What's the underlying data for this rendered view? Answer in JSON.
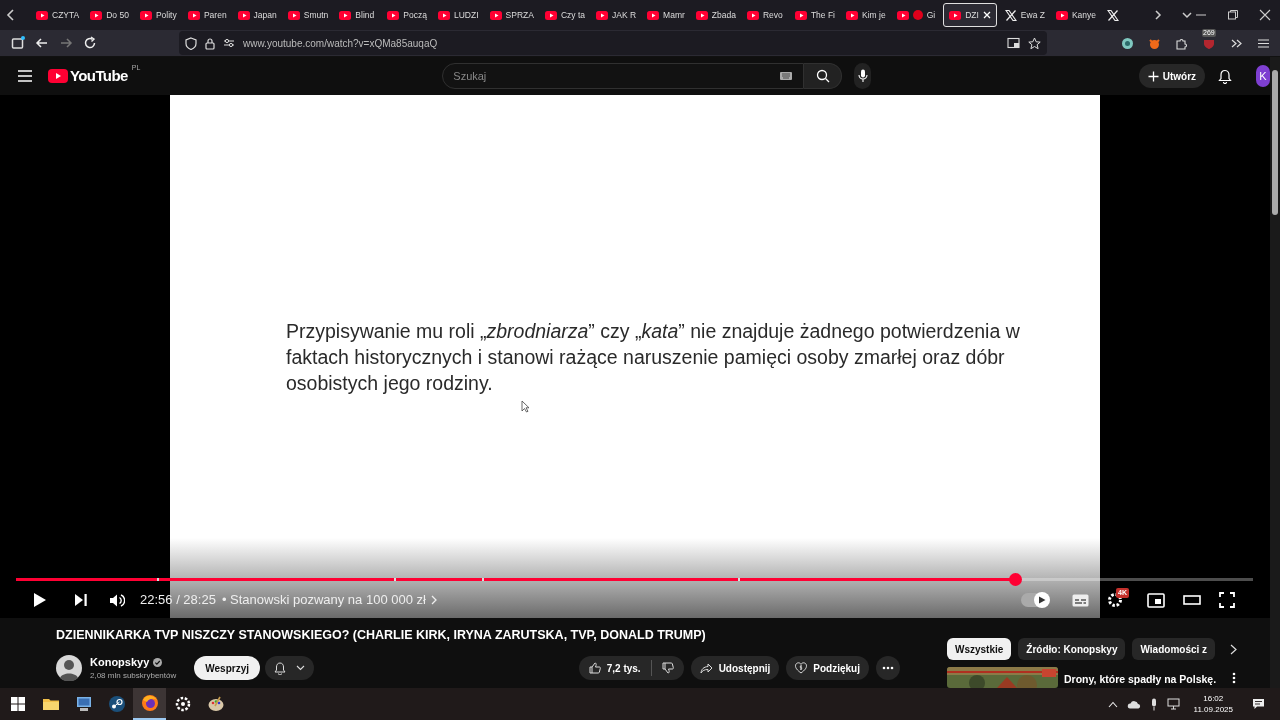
{
  "browser": {
    "tabs": [
      {
        "label": "CZYTA",
        "kind": "youtube",
        "selected": false
      },
      {
        "label": "Do 50",
        "kind": "youtube",
        "selected": false
      },
      {
        "label": "Polity",
        "kind": "youtube",
        "selected": false
      },
      {
        "label": "Paren",
        "kind": "youtube",
        "selected": false
      },
      {
        "label": "Japan",
        "kind": "youtube",
        "selected": false
      },
      {
        "label": "Smutn",
        "kind": "youtube",
        "selected": false
      },
      {
        "label": "Blind",
        "kind": "youtube",
        "selected": false
      },
      {
        "label": "Począ",
        "kind": "youtube",
        "selected": false
      },
      {
        "label": "LUDZI",
        "kind": "youtube",
        "selected": false
      },
      {
        "label": "SPRZA",
        "kind": "youtube",
        "selected": false
      },
      {
        "label": "Czy ta",
        "kind": "youtube",
        "selected": false
      },
      {
        "label": "JAK R",
        "kind": "youtube",
        "selected": false
      },
      {
        "label": "Mamr",
        "kind": "youtube",
        "selected": false
      },
      {
        "label": "Zbada",
        "kind": "youtube",
        "selected": false
      },
      {
        "label": "Revo",
        "kind": "youtube",
        "selected": false
      },
      {
        "label": "The Fi",
        "kind": "youtube",
        "selected": false
      },
      {
        "label": "Kim je",
        "kind": "youtube",
        "selected": false
      },
      {
        "label": "Gi",
        "kind": "recording",
        "selected": false
      },
      {
        "label": "DZI",
        "kind": "youtube",
        "selected": true
      },
      {
        "label": "Ewa Z",
        "kind": "x",
        "selected": false
      },
      {
        "label": "Kanye",
        "kind": "youtube",
        "selected": false
      },
      {
        "kind": "x",
        "selected": false
      }
    ],
    "url": "www.youtube.com/watch?v=xQMa85auqaQ",
    "extension_badge": "269"
  },
  "youtube": {
    "logo_text": "YouTube",
    "region": "PL",
    "search": {
      "placeholder": "Szukaj"
    },
    "create_button": "Utwórz",
    "avatar_letter": "K"
  },
  "player": {
    "frame_text": "Przypisywanie mu roli „*zbrodniarza*” czy „*kata*” nie znajduje żadnego potwierdzenia w faktach historycznych i stanowi rażące naruszenie pamięci osoby zmarłej oraz dóbr osobistych jego rodziny.",
    "progress": {
      "level": 0.808
    },
    "time": "22:56 / 28:25",
    "chapter": "• Stanowski pozwany na 100 000 zł",
    "autoplay": true,
    "quality_badge": "4K"
  },
  "video": {
    "title": "DZIENNIKARKA TVP NISZCZY STANOWSKIEGO? (CHARLIE KIRK, IRYNA ZARUTSKA, TVP, DONALD TRUMP)",
    "channel": "Konopskyy",
    "verified": true,
    "subscribers": "2,08 mln subskrybentów",
    "support_button": "Wesprzyj",
    "likes": "7,2 tys.",
    "share": "Udostępnij",
    "thanks": "Podziękuj"
  },
  "filters": [
    {
      "label": "Wszystkie",
      "selected": true
    },
    {
      "label": "Źródło: Konopskyy",
      "selected": false
    },
    {
      "label": "Wiadomości z",
      "selected": false
    }
  ],
  "recommended": [
    {
      "kind": "picture",
      "title": "Drony, które spadły na Polskę."
    }
  ],
  "taskbar": {
    "apps": [
      {
        "kind": "start",
        "selected": false
      },
      {
        "kind": "folder",
        "selected": false
      },
      {
        "kind": "computer",
        "selected": false
      },
      {
        "kind": "steam",
        "selected": false
      },
      {
        "kind": "firefox",
        "selected": true
      },
      {
        "kind": "gear",
        "selected": false
      },
      {
        "kind": "palette",
        "selected": false
      }
    ],
    "time": "16:02",
    "date": "11.09.2025"
  }
}
